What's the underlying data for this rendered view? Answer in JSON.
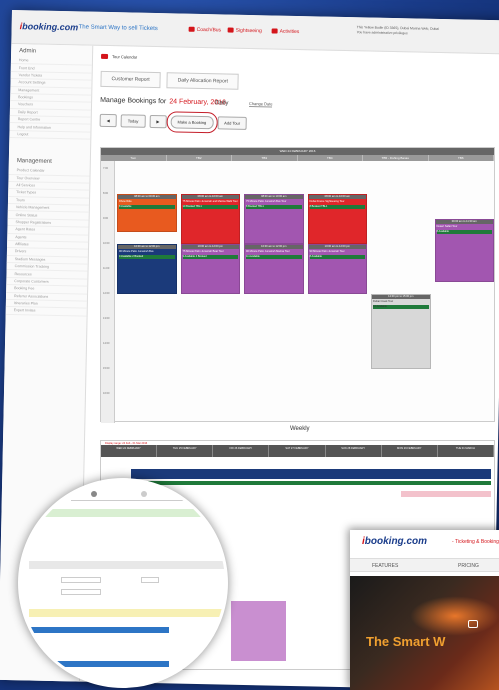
{
  "header": {
    "logo_prefix": "i",
    "logo_text": "booking.com",
    "tagline": "The Smart Way to sell Tickets",
    "nav": [
      "Coach/Bus",
      "Sightseeing",
      "Activities"
    ],
    "user_line1": "This Yellow Budle (ID 3365), Dubai Marina Web, Dubai",
    "user_line2": "You have administrative privileges"
  },
  "sidebar": {
    "section1_title": "Admin",
    "section1_items": [
      "Home",
      "Front End",
      "Vendor Tickets",
      "Account Settings",
      "Management",
      "Bookings",
      "Vouchers",
      "Daily Report",
      "Report Centre",
      "Help and Information",
      "Logout"
    ],
    "section2_title": "Management",
    "section2_items": [
      "Product Calendar",
      "Tour Overview",
      "All Services",
      "Ticket Types",
      "Tours",
      "Vehicle Management",
      "Online Status",
      "Shopper Registrations",
      "Agent Rates",
      "Agents",
      "Affiliates",
      "Drivers",
      "Stadium Messages",
      "Commission Tracking",
      "Resources",
      "Corporate Customers",
      "Booking Fee",
      "Referrer Associations",
      "Itineraries Plan",
      "Expert Invites"
    ]
  },
  "main": {
    "breadcrumb": "Tour Calendar",
    "tabs": [
      "Customer Report",
      "Daily Allocation Report"
    ],
    "title_prefix": "Manage Bookings for",
    "title_date": "24 February, 2016",
    "change_date": "Change Date",
    "toolbar": [
      "Today",
      "Make a Booking",
      "Add Tour"
    ],
    "daily_label": "Daily",
    "weekly_label": "Weekly"
  },
  "calendar": {
    "header": "WED 24 FEBRUARY 2016",
    "columns": [
      "Tom",
      "TB2",
      "TB3",
      "TB4",
      "TB5 - Fishing Banas",
      "TB6"
    ],
    "times": [
      "7:00",
      "8:00",
      "9:00",
      "10:00",
      "11:00",
      "12:00",
      "13:00",
      "14:00",
      "15:00",
      "16:00"
    ],
    "events": [
      {
        "col": 0,
        "color": "#e85a1f",
        "time": "08:00 am to 09:30 am",
        "title": "Dhow Ride",
        "available": "8 Available"
      },
      {
        "col": 1,
        "color": "#e0262a",
        "time": "08:00 am to 10:00 am",
        "title": "75 Minute Palm Jumeirah and Marina Walk Tour",
        "available": "10 Booked  TBL1"
      },
      {
        "col": 2,
        "color": "#a256b0",
        "time": "08:00 am to 10:00 am",
        "title": "75 Minute Palm Jumeirah Bus Tour",
        "available": "8 Booked  TBL1"
      },
      {
        "col": 3,
        "color": "#e0262a",
        "time": "08:00 am to 10:00 am",
        "title": "Dubai Frame Sightseeing Tour",
        "available": "8 Booked  TBL1"
      },
      {
        "col": 0,
        "color": "#1b3a7a",
        "time": "10:00 am to 12:00 pm",
        "title": "90 Minute Palm Jumeirah Bus",
        "available": "4 Available  2 Booked"
      },
      {
        "col": 1,
        "color": "#a256b0",
        "time": "10:00 am to 12:00 pm",
        "title": "75 Minute Palm Jumeirah Boat Tour",
        "available": "3 Available  4 Booked"
      },
      {
        "col": 2,
        "color": "#a256b0",
        "time": "10:00 am to 12:00 pm",
        "title": "90 Minute Palm Jumeirah Marina Tour",
        "available": "11 Available"
      },
      {
        "col": 3,
        "color": "#a256b0",
        "time": "10:00 am to 12:00 pm",
        "title": "90 Minute Palm Jumeirah Tour",
        "available": "8 Available"
      },
      {
        "col": 4,
        "color": "#d8d8d8",
        "time": "12:00 pm to 15:00 pm",
        "title": "Dubai Creek Tour",
        "available": "16 Available"
      },
      {
        "col": 5,
        "color": "#a256b0",
        "time": "09:00 am to 11:30 am",
        "title": "Desert Safari Tour",
        "available": "8 Available"
      }
    ]
  },
  "weekly": {
    "notice": "Display range: 24 Feb - 01 Mar 2016",
    "days": [
      "WED 24 FEBRUARY",
      "THU 25 FEBRUARY",
      "FRI 26 FEBRUARY",
      "SAT 27 FEBRUARY",
      "SUN 28 FEBRUARY",
      "MON 29 FEBRUARY",
      "TUE 01 MARCH"
    ]
  },
  "site": {
    "logo_prefix": "i",
    "logo_text": "booking.com",
    "tagline": "- Ticketing & Booking",
    "nav": [
      "FEATURES",
      "PRICING"
    ],
    "hero_text": "The Smart W"
  }
}
